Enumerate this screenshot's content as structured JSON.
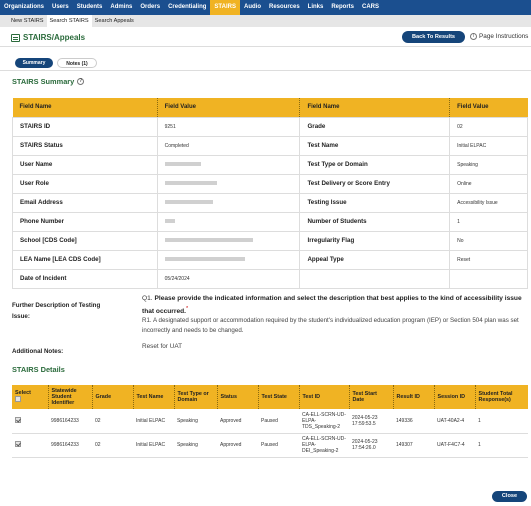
{
  "topnav": [
    "Organizations",
    "Users",
    "Students",
    "Admins",
    "Orders",
    "Credentialing",
    "STAIRS",
    "Audio",
    "Resources",
    "Links",
    "Reports",
    "CARS"
  ],
  "subnav": [
    "New STAIRS",
    "Search STAIRS",
    "Search Appeals"
  ],
  "page": {
    "title": "STAIRS/Appeals",
    "back_button": "Back To Results",
    "instructions": "Page Instructions"
  },
  "tabs": [
    "Summary",
    "Notes (1)"
  ],
  "summary": {
    "heading": "STAIRS Summary",
    "headers": [
      "Field Name",
      "Field Value",
      "Field Name",
      "Field Value"
    ],
    "rows": [
      {
        "l1": "STAIRS ID",
        "v1": "9251",
        "l2": "Grade",
        "v2": "02"
      },
      {
        "l1": "STAIRS Status",
        "v1": "Completed",
        "l2": "Test Name",
        "v2": "Initial ELPAC"
      },
      {
        "l1": "User Name",
        "v1": "",
        "l2": "Test Type or Domain",
        "v2": "Speaking"
      },
      {
        "l1": "User Role",
        "v1": "",
        "l2": "Test Delivery or Score Entry",
        "v2": "Online"
      },
      {
        "l1": "Email Address",
        "v1": "",
        "l2": "Testing Issue",
        "v2": "Accessibility Issue"
      },
      {
        "l1": "Phone Number",
        "v1": "",
        "l2": "Number of Students",
        "v2": "1"
      },
      {
        "l1": "School [CDS Code]",
        "v1": "",
        "l2": "Irregularity Flag",
        "v2": "No"
      },
      {
        "l1": "LEA Name [LEA CDS Code]",
        "v1": "",
        "l2": "Appeal Type",
        "v2": "Reset"
      },
      {
        "l1": "Date of Incident",
        "v1": "05/24/2024",
        "l2": "",
        "v2": ""
      }
    ]
  },
  "further": {
    "label": "Further Description of Testing Issue:",
    "q_prefix": "Q1.",
    "question": "Please provide the indicated information and select the description that best applies to the kind of accessibility issue that occurred.",
    "required_mark": "*",
    "answer": "R1. A designated support or accommodation required by the student's individualized education program (IEP) or Section 504 plan was set incorrectly and needs to be changed."
  },
  "notes": {
    "label": "Additional Notes:",
    "value": "Reset for UAT"
  },
  "details": {
    "heading": "STAIRS Details",
    "headers": [
      "Select",
      "Statewide Student Identifier",
      "Grade",
      "Test Name",
      "Test Type or Domain",
      "Status",
      "Test State",
      "Test ID",
      "Test Start Date",
      "Result ID",
      "Session ID",
      "Student Total Response(s)"
    ],
    "rows": [
      {
        "ssid": "9986164233",
        "grade": "02",
        "test_name": "Initial ELPAC",
        "domain": "Speaking",
        "status": "Approved",
        "state": "Paused",
        "test_id": "CA-ELL-SCRN-UD-ELPA-TDS_Speaking-2",
        "start": "2024-05-23 17:59:53.5",
        "result_id": "149336",
        "session_id": "UAT-40A2-4",
        "responses": "1"
      },
      {
        "ssid": "9986164233",
        "grade": "02",
        "test_name": "Initial ELPAC",
        "domain": "Speaking",
        "status": "Approved",
        "state": "Paused",
        "test_id": "CA-ELL-SCRN-UD-ELPA-DEI_Speaking-2",
        "start": "2024-05-23 17:54:26.0",
        "result_id": "149307",
        "session_id": "UAT-F4C7-4",
        "responses": "1"
      }
    ]
  },
  "close_button": "Close",
  "colors": {
    "nav": "#1b4f8f",
    "accent": "#f0b323",
    "heading": "#2b6b3c",
    "button": "#15457a"
  }
}
